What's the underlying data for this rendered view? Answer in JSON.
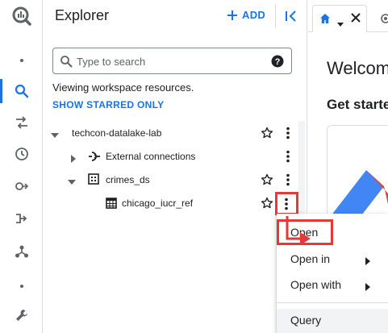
{
  "explorer": {
    "title": "Explorer",
    "add_label": "ADD",
    "search_placeholder": "Type to search",
    "viewing_text": "Viewing workspace resources.",
    "show_starred_label": "SHOW STARRED ONLY"
  },
  "tree": {
    "project": "techcon-datalake-lab",
    "external": "External connections",
    "dataset": "crimes_ds",
    "table": "chicago_iucr_ref"
  },
  "right": {
    "welcome": "Welcom",
    "get_started": "Get starte"
  },
  "context_menu": {
    "items": [
      "Open",
      "Open in",
      "Open with",
      "Query"
    ]
  },
  "icons": {
    "rail": [
      "bigquery-logo",
      "dot",
      "search",
      "transfers",
      "schedule",
      "analytics-hub",
      "pipelines",
      "dataform",
      "dot",
      "wrench"
    ],
    "highlight_color": "#e53935",
    "accent_color": "#1a73e8"
  }
}
